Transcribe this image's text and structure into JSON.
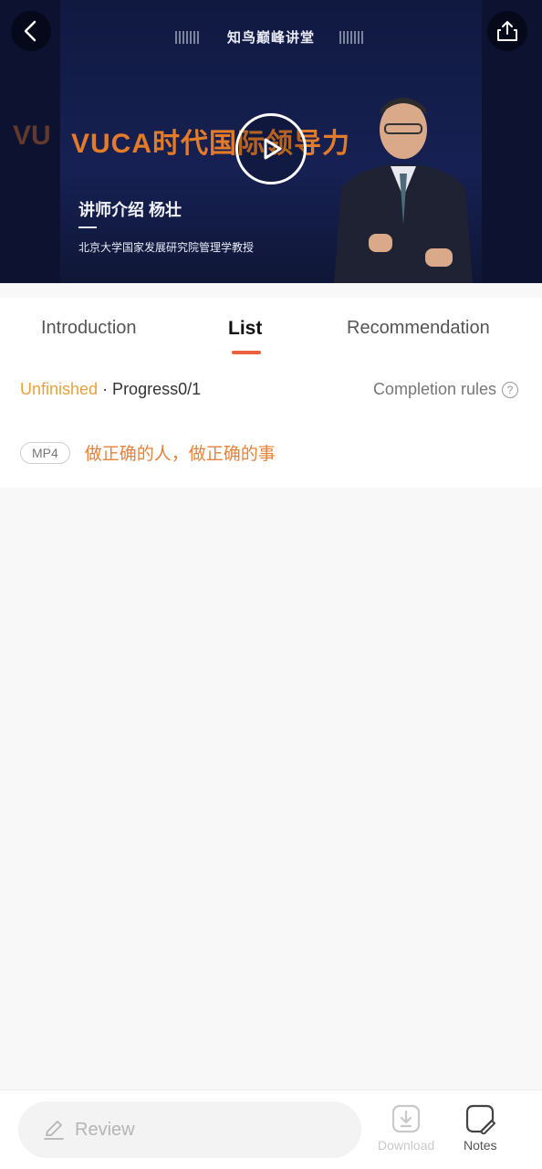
{
  "video": {
    "brand": "知鸟巅峰讲堂",
    "headline": "VUCA时代国际领导力",
    "lecturer": "讲师介绍   杨壮",
    "lecturer_title": "北京大学国家发展研究院管理学教授",
    "icons": {
      "back": "back-arrow-icon",
      "share": "share-icon",
      "play": "play-icon"
    }
  },
  "tabs": [
    {
      "label": "Introduction",
      "active": false
    },
    {
      "label": "List",
      "active": true
    },
    {
      "label": "Recommendation",
      "active": false
    }
  ],
  "progress": {
    "status": "Unfinished",
    "text": " · Progress0/1",
    "completed": 0,
    "total": 1,
    "rules_label": "Completion rules"
  },
  "items": [
    {
      "badge": "MP4",
      "title": "做正确的人，做正确的事"
    }
  ],
  "bottom_bar": {
    "review_placeholder": "Review",
    "download_label": "Download",
    "notes_label": "Notes"
  },
  "colors": {
    "accent": "#e9613f",
    "status": "#e8a23a",
    "item_title": "#e8823a"
  }
}
